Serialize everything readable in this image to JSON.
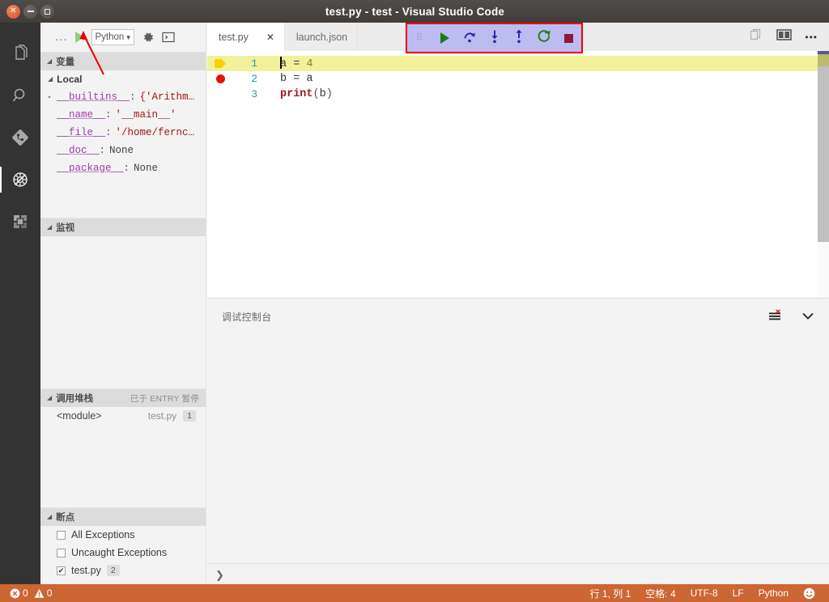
{
  "window": {
    "title": "test.py - test - Visual Studio Code",
    "buttons": {
      "close": "close-icon",
      "minimize": "minimize-icon",
      "maximize": "maximize-icon"
    }
  },
  "activity_bar": {
    "items": [
      {
        "name": "explorer",
        "icon": "files-icon",
        "active": false
      },
      {
        "name": "search",
        "icon": "search-icon",
        "active": false
      },
      {
        "name": "source-control",
        "icon": "source-control-icon",
        "active": false
      },
      {
        "name": "run-and-debug",
        "icon": "debug-icon",
        "active": true
      },
      {
        "name": "extensions",
        "icon": "extensions-icon",
        "active": false
      }
    ]
  },
  "debug_sidebar": {
    "header": {
      "more_label": "...",
      "start_label": "start-debug-icon",
      "configuration": "Python",
      "config_caret": "▼",
      "gear_label": "gear-icon",
      "console_label": "open-console-icon"
    },
    "variables": {
      "title": "变量",
      "twisty": "◢",
      "scope": {
        "label": "Local",
        "twisty": "◢"
      },
      "rows": [
        {
          "twisty": "▸",
          "name": "__builtins__",
          "value": "{'Arithm…",
          "none": false
        },
        {
          "twisty": "",
          "name": "__name__",
          "value": "'__main__'",
          "none": false
        },
        {
          "twisty": "",
          "name": "__file__",
          "value": "'/home/fernc…",
          "none": false
        },
        {
          "twisty": "",
          "name": "__doc__",
          "value": "None",
          "none": true
        },
        {
          "twisty": "",
          "name": "__package__",
          "value": "None",
          "none": true
        }
      ]
    },
    "watch": {
      "title": "监视",
      "twisty": "◢",
      "items": []
    },
    "call_stack": {
      "title": "调用堆栈",
      "twisty": "◢",
      "status": "已于 ENTRY 暂停",
      "rows": [
        {
          "frame": "<module>",
          "file": "test.py",
          "line": "1"
        }
      ]
    },
    "breakpoints": {
      "title": "断点",
      "twisty": "◢",
      "rows": [
        {
          "label": "All Exceptions",
          "checked": false,
          "badge": ""
        },
        {
          "label": "Uncaught Exceptions",
          "checked": false,
          "badge": ""
        },
        {
          "label": "test.py",
          "checked": true,
          "badge": "2"
        }
      ]
    }
  },
  "editor": {
    "tabs": [
      {
        "label": "test.py",
        "active": true,
        "close": "✕"
      },
      {
        "label": "launch.json",
        "active": false,
        "close": ""
      }
    ],
    "actions": {
      "split": "split-editor-icon",
      "layout": "editor-layout-icon",
      "more": "•••"
    },
    "lines": [
      {
        "number": "1",
        "glyph": "execution-pointer",
        "current": true,
        "tokens": [
          {
            "t": "caret",
            "s": ""
          },
          {
            "t": "var",
            "s": "a"
          },
          {
            "t": "plain",
            "s": " = "
          },
          {
            "t": "num",
            "s": "4"
          }
        ]
      },
      {
        "number": "2",
        "glyph": "breakpoint",
        "current": false,
        "tokens": [
          {
            "t": "var",
            "s": "b"
          },
          {
            "t": "plain",
            "s": " = "
          },
          {
            "t": "var",
            "s": "a"
          }
        ]
      },
      {
        "number": "3",
        "glyph": "",
        "current": false,
        "tokens": [
          {
            "t": "fn",
            "s": "print"
          },
          {
            "t": "paren",
            "s": "("
          },
          {
            "t": "var",
            "s": "b"
          },
          {
            "t": "paren",
            "s": ")"
          }
        ]
      }
    ]
  },
  "debug_toolbar": {
    "buttons": [
      {
        "name": "drag-handle",
        "icon": "grip-icon"
      },
      {
        "name": "continue",
        "icon": "play-icon"
      },
      {
        "name": "step-over",
        "icon": "step-over-icon"
      },
      {
        "name": "step-into",
        "icon": "step-into-icon"
      },
      {
        "name": "step-out",
        "icon": "step-out-icon"
      },
      {
        "name": "restart",
        "icon": "restart-icon"
      },
      {
        "name": "stop",
        "icon": "stop-icon"
      }
    ],
    "highlight_color": "#ee0000"
  },
  "panel": {
    "title": "调试控制台",
    "actions": {
      "clear": "clear-console-icon",
      "collapse": "chevron-down-icon"
    },
    "repl_prompt": "❯",
    "output": ""
  },
  "status_bar": {
    "background": "#cc6633",
    "errors": "0",
    "warnings": "0",
    "error_icon": "error-icon",
    "warning_icon": "warning-icon",
    "position": "行 1, 列 1",
    "indent": "空格: 4",
    "encoding": "UTF-8",
    "eol": "LF",
    "language": "Python",
    "feedback_icon": "smiley-icon"
  }
}
